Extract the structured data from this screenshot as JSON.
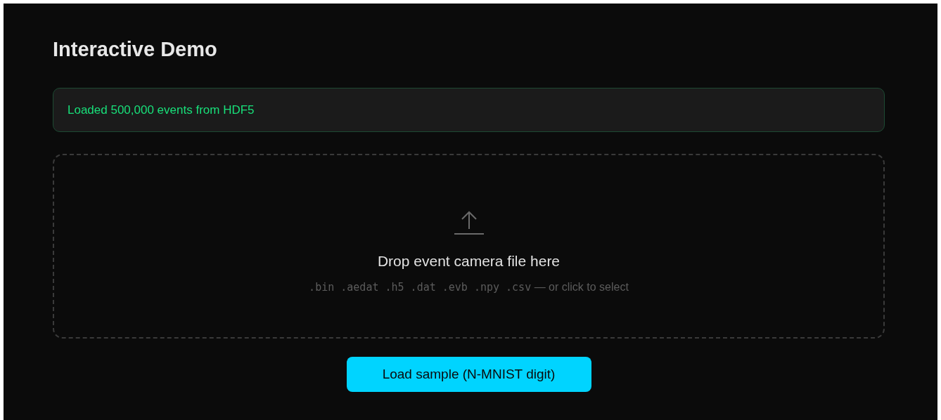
{
  "title": "Interactive Demo",
  "status": {
    "text": "Loaded 500,000 events from HDF5",
    "kind": "success"
  },
  "dropzone": {
    "heading": "Drop event camera file here",
    "formats": ".bin .aedat .h5 .dat .evb .npy .csv",
    "hint": "— or click to select"
  },
  "button": {
    "label": "Load sample (N-MNIST digit)"
  }
}
